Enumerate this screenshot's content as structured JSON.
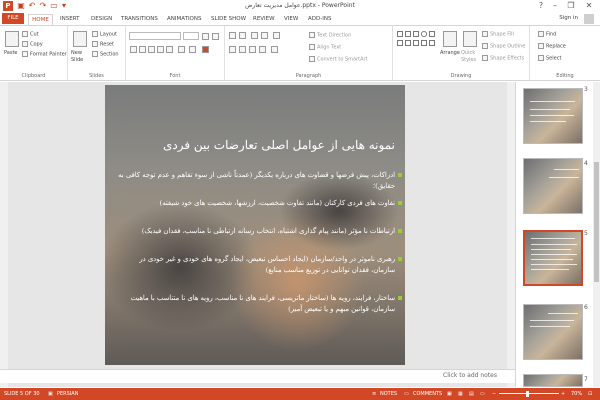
{
  "titlebar": {
    "title": "عوامل مدیریت تعارض.pptx - PowerPoint",
    "app_icon": "P",
    "help": "?",
    "minimize": "–",
    "restore": "❐",
    "close": "✕"
  },
  "tabs": [
    "FILE",
    "HOME",
    "INSERT",
    "DESIGN",
    "TRANSITIONS",
    "ANIMATIONS",
    "SLIDE SHOW",
    "REVIEW",
    "VIEW",
    "ADD-INS"
  ],
  "user": {
    "sign_in": "Sign in"
  },
  "ribbon": {
    "clipboard": {
      "paste": "Paste",
      "cut": "Cut",
      "copy": "Copy",
      "format_painter": "Format Painter",
      "label": "Clipboard"
    },
    "slides": {
      "new_slide": "New Slide",
      "layout": "Layout",
      "reset": "Reset",
      "section": "Section",
      "label": "Slides"
    },
    "font": {
      "label": "Font"
    },
    "paragraph": {
      "text_direction": "Text Direction",
      "align_text": "Align Text",
      "convert": "Convert to SmartArt",
      "label": "Paragraph"
    },
    "drawing": {
      "arrange": "Arrange",
      "quick_styles": "Quick Styles",
      "shape_fill": "Shape Fill",
      "shape_outline": "Shape Outline",
      "shape_effects": "Shape Effects",
      "label": "Drawing"
    },
    "editing": {
      "find": "Find",
      "replace": "Replace",
      "select": "Select",
      "label": "Editing"
    }
  },
  "slide": {
    "title": "نمونه هایی از عوامل اصلی تعارضات بین فردی",
    "bullets": [
      "ادراکات، پیش فرضها و قضاوت های درباره یکدیگر (عمدتاً ناشی از سوء تفاهم و عدم توجه کافی به حقایق)؛",
      "تفاوت های فردی کارکنان (مانند تفاوت شخصیت، ارزشها، شخصیت های خود شیفته)",
      "ارتباطات نا مؤثر (مانند پیام گذاری اشتباه، انتخاب رسانه ارتباطی نا مناسب، فقدان فیدبک)",
      "رهبری ناموثر در واحد/سازمان (ایجاد احساس تبعیض، ایجاد گروه های خودی و غیر خودی در سازمان، فقدان توانایی در توزیع مناسب منابع)",
      "ساختار، فرایند، رویه ها (ساختار ماتریسی، فرایند های نا مناسب، رویه های نا متناسب با ماهیت سازمان، قوانین مبهم و یا تبعیض آمیز)"
    ]
  },
  "notes_hint": "Click to add notes",
  "thumbnails": [
    {
      "num": "3",
      "selected": false
    },
    {
      "num": "4",
      "selected": false
    },
    {
      "num": "5",
      "selected": true
    },
    {
      "num": "6",
      "selected": false
    },
    {
      "num": "7",
      "selected": false
    }
  ],
  "status": {
    "slide_info": "SLIDE 5 OF 30",
    "language": "PERSIAN",
    "notes": "NOTES",
    "comments": "COMMENTS",
    "zoom": "70%"
  },
  "colors": {
    "accent": "#d24726",
    "bullet": "#9acd32"
  }
}
